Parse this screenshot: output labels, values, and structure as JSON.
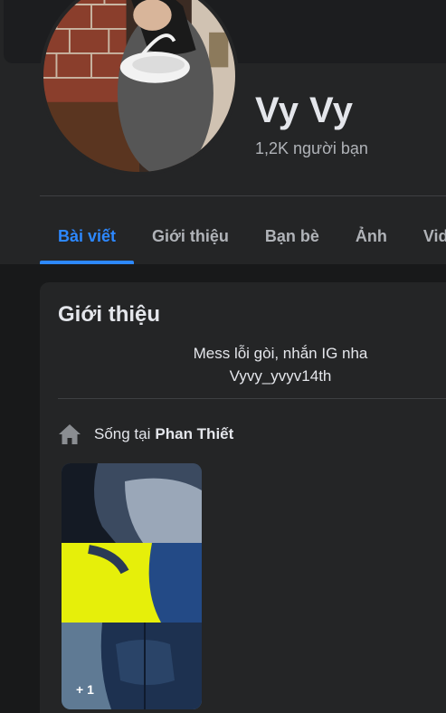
{
  "profile": {
    "name": "Vy Vy",
    "friends": "1,2K người bạn"
  },
  "tabs": [
    {
      "label": "Bài viết",
      "active": true
    },
    {
      "label": "Giới thiệu",
      "active": false
    },
    {
      "label": "Bạn bè",
      "active": false
    },
    {
      "label": "Ảnh",
      "active": false
    },
    {
      "label": "Video",
      "active": false
    }
  ],
  "intro": {
    "title": "Giới thiệu",
    "bio_line1": "Mess lỗi gòi, nhắn IG nha",
    "bio_line2": "Vyvy_yvyv14th",
    "lives_prefix": "Sống tại",
    "lives_place": "Phan Thiết",
    "featured_more": "+ 1"
  },
  "colors": {
    "accent": "#2d88ff",
    "card_bg": "#242526",
    "page_bg": "#18191a",
    "text_primary": "#e4e6eb",
    "text_secondary": "#b0b3b8"
  },
  "icons": {
    "lives": "home-icon"
  }
}
